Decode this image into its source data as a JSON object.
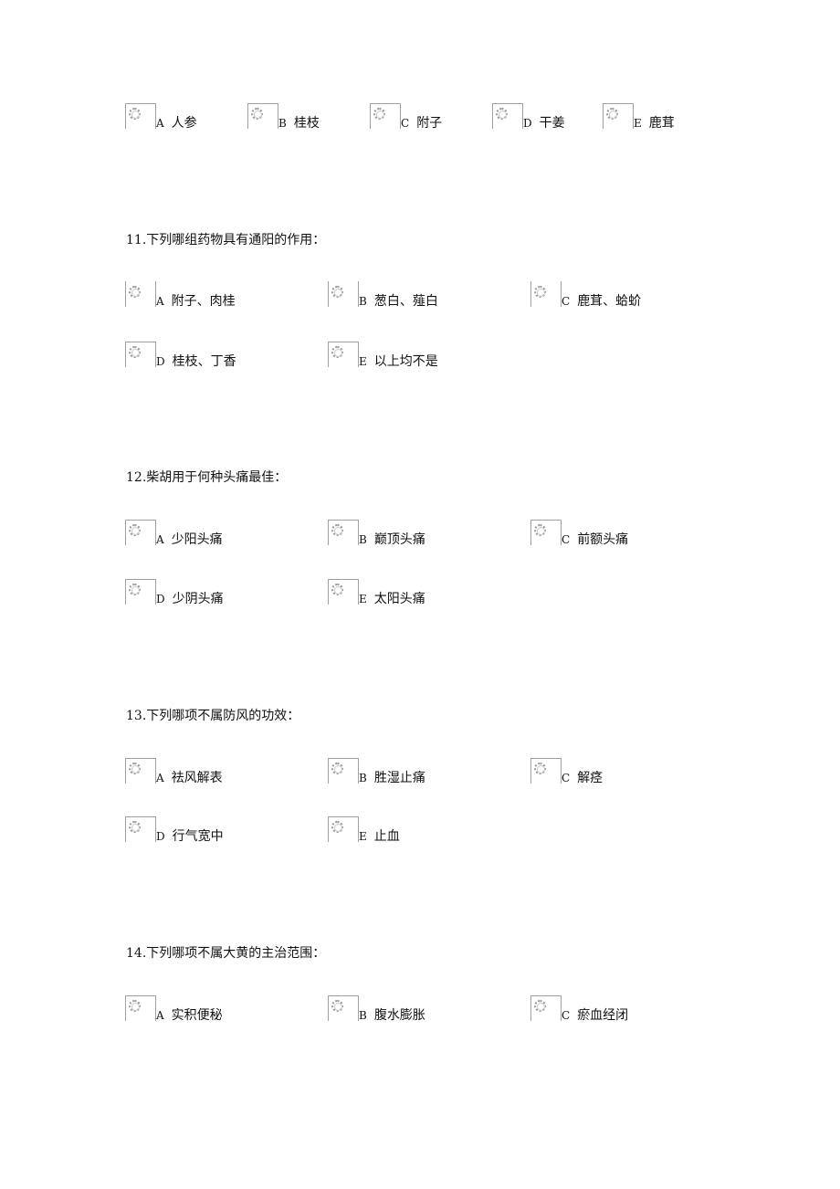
{
  "questions": [
    {
      "title": "",
      "options": [
        {
          "letter": "A",
          "text": "人参"
        },
        {
          "letter": "B",
          "text": "桂枝"
        },
        {
          "letter": "C",
          "text": "附子"
        },
        {
          "letter": "D",
          "text": "干姜"
        },
        {
          "letter": "E",
          "text": "鹿茸"
        }
      ]
    },
    {
      "title": "11.下列哪组药物具有通阳的作用：",
      "options": [
        {
          "letter": "A",
          "text": "附子、肉桂"
        },
        {
          "letter": "B",
          "text": "葱白、薤白"
        },
        {
          "letter": "C",
          "text": "鹿茸、蛤蚧"
        },
        {
          "letter": "D",
          "text": "桂枝、丁香"
        },
        {
          "letter": "E",
          "text": "以上均不是"
        }
      ]
    },
    {
      "title": "12.柴胡用于何种头痛最佳：",
      "options": [
        {
          "letter": "A",
          "text": "少阳头痛"
        },
        {
          "letter": "B",
          "text": "巅顶头痛"
        },
        {
          "letter": "C",
          "text": "前额头痛"
        },
        {
          "letter": "D",
          "text": "少阴头痛"
        },
        {
          "letter": "E",
          "text": "太阳头痛"
        }
      ]
    },
    {
      "title": "13.下列哪项不属防风的功效：",
      "options": [
        {
          "letter": "A",
          "text": "祛风解表"
        },
        {
          "letter": "B",
          "text": "胜湿止痛"
        },
        {
          "letter": "C",
          "text": "解痉"
        },
        {
          "letter": "D",
          "text": "行气宽中"
        },
        {
          "letter": "E",
          "text": "止血"
        }
      ]
    },
    {
      "title": "14.下列哪项不属大黄的主治范围：",
      "options": [
        {
          "letter": "A",
          "text": "实积便秘"
        },
        {
          "letter": "B",
          "text": "腹水膨胀"
        },
        {
          "letter": "C",
          "text": "瘀血经闭"
        }
      ]
    }
  ]
}
